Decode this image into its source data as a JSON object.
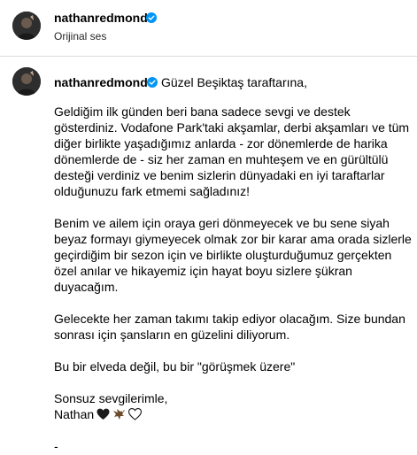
{
  "header": {
    "username": "nathanredmond",
    "audio_label": "Orijinal ses"
  },
  "caption": {
    "username": "nathanredmond",
    "greeting": "Güzel Beşiktaş taraftarına,",
    "paragraphs": [
      "Geldiğim ilk günden beri bana sadece sevgi ve destek\ngösterdiniz. Vodafone Park'taki akşamlar, derbi akşamları ve tüm\ndiğer birlikte yaşadığımız anlarda - zor dönemlerde de harika\ndönemlerde de - siz her zaman en muhteşem ve en gürültülü\ndesteği verdiniz ve benim sizlerin dünyadaki en iyi taraftarlar\nolduğunuzu fark etmemi sağladınız!",
      "Benim ve ailem için oraya geri dönmeyecek ve bu sene siyah\nbeyaz formayı giymeyecek olmak zor bir karar ama orada sizlerle\ngeçirdiğim bir sezon için ve birlikte oluşturduğumuz gerçekten\nözel anılar ve hikayemiz için hayat boyu sizlere şükran\nduyacağım.",
      "Gelecekte her zaman takımı takip ediyor olacağım. Size bundan\nsonrası için şansların en güzelini diliyorum.",
      "Bu bir elveda değil, bu bir \"görüşmek üzere\""
    ],
    "closing": "Sonsuz sevgilerimle,",
    "signature": "Nathan",
    "emojis": [
      "black-heart-icon",
      "eagle-icon",
      "white-heart-icon"
    ],
    "trailing": "-"
  },
  "colors": {
    "verified_badge": "#0095f6",
    "divider": "#dbdbdb",
    "secondary_text": "#262626"
  }
}
